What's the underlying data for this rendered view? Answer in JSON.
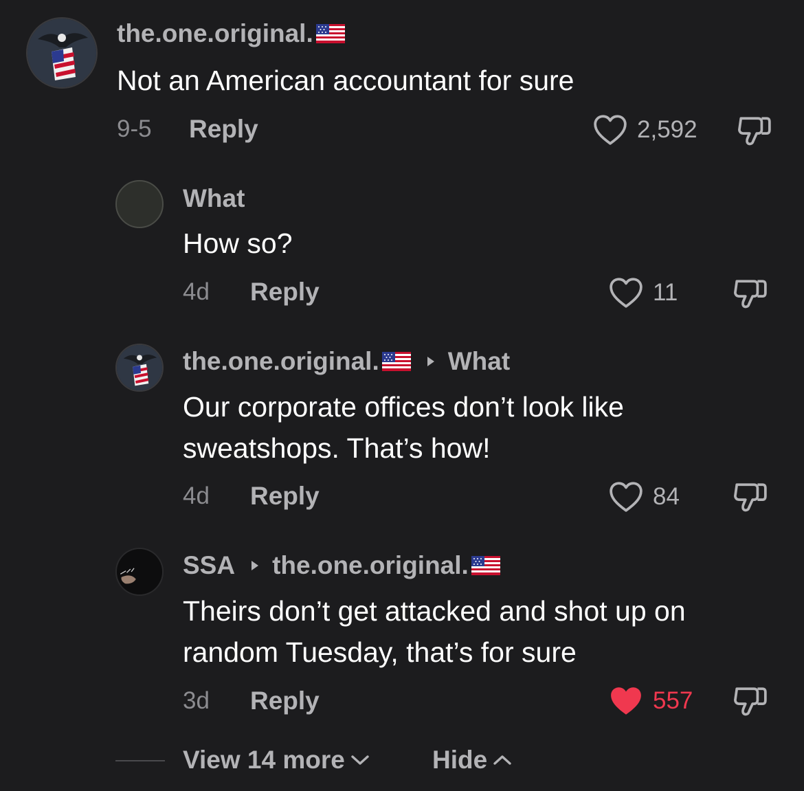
{
  "comments": [
    {
      "username": "the.one.original.",
      "text": "Not an American accountant for sure",
      "date": "9-5",
      "reply_label": "Reply",
      "likes": "2,592",
      "liked": false
    },
    {
      "username": "What",
      "text": "How so?",
      "date": "4d",
      "reply_label": "Reply",
      "likes": "11",
      "liked": false
    },
    {
      "username": "the.one.original.",
      "reply_to": "What",
      "text_line1": "Our corporate offices don’t look like",
      "text_line2": "sweatshops. That’s how!",
      "date": "4d",
      "reply_label": "Reply",
      "likes": "84",
      "liked": false
    },
    {
      "username": "SSA",
      "reply_to": "the.one.original.",
      "text_line1": "Theirs don’t get attacked and shot up on",
      "text_line2": "random Tuesday, that’s for sure",
      "date": "3d",
      "reply_label": "Reply",
      "likes": "557",
      "liked": true
    }
  ],
  "footer": {
    "view_more_label": "View 14 more",
    "hide_label": "Hide"
  },
  "colors": {
    "background": "#1c1c1e",
    "like_active": "#f0384f",
    "secondary_text": "#b3b3b6"
  }
}
